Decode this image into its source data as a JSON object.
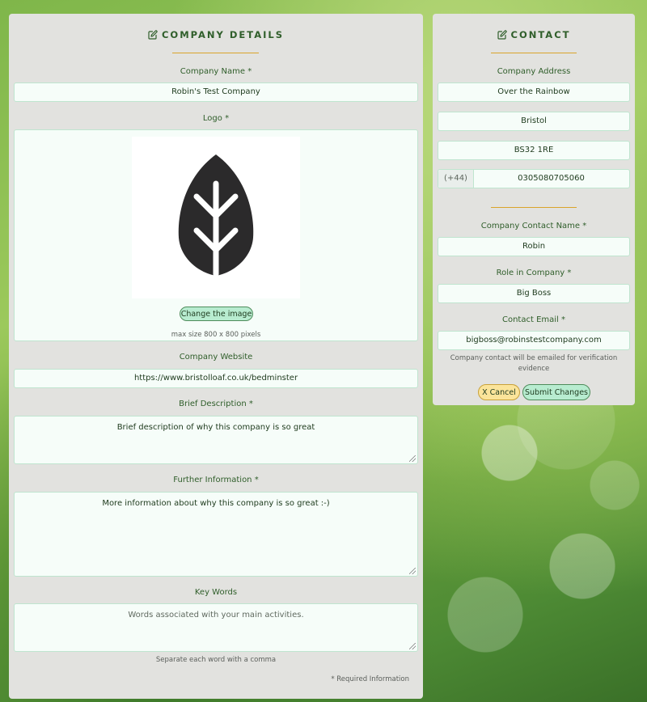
{
  "company": {
    "heading": "COMPANY DETAILS",
    "name_label": "Company Name *",
    "name_value": "Robin's Test Company",
    "logo_label": "Logo *",
    "change_image_label": "Change the image",
    "logo_note": "max size 800 x 800 pixels",
    "website_label": "Company Website",
    "website_value": "https://www.bristolloaf.co.uk/bedminster",
    "brief_label": "Brief Description *",
    "brief_value": "Brief description of why this company is so great",
    "further_label": "Further Information *",
    "further_value": "More information about why this company is so great :-)",
    "keywords_label": "Key Words",
    "keywords_placeholder": "Words associated with your main activities.",
    "keywords_note": "Separate each word with a comma",
    "required_note": "* Required Information"
  },
  "contact": {
    "heading": "CONTACT",
    "address_label": "Company Address",
    "address_line1": "Over the Rainbow",
    "address_line2": "Bristol",
    "postcode": "BS32 1RE",
    "phone_prefix": "(+44)",
    "phone": "0305080705060",
    "contact_name_label": "Company Contact Name *",
    "contact_name_value": "Robin",
    "role_label": "Role in Company *",
    "role_value": "Big Boss",
    "email_label": "Contact Email *",
    "email_value": "bigboss@robinstestcompany.com",
    "verification_note": "Company contact will be emailed for verification evidence",
    "cancel_label": "X Cancel",
    "submit_label": "Submit Changes"
  },
  "icons": {
    "heading_icon": "edit-icon",
    "logo_image": "leaf-icon"
  },
  "colors": {
    "panel_bg": "#e2e2df",
    "heading_text": "#2f5e2a",
    "accent_rule": "#d9a42b",
    "field_bg": "#f6fdf9",
    "field_border": "#bfe5cf",
    "primary_button": "#b8ecd0",
    "cancel_button": "#fbe49a"
  }
}
